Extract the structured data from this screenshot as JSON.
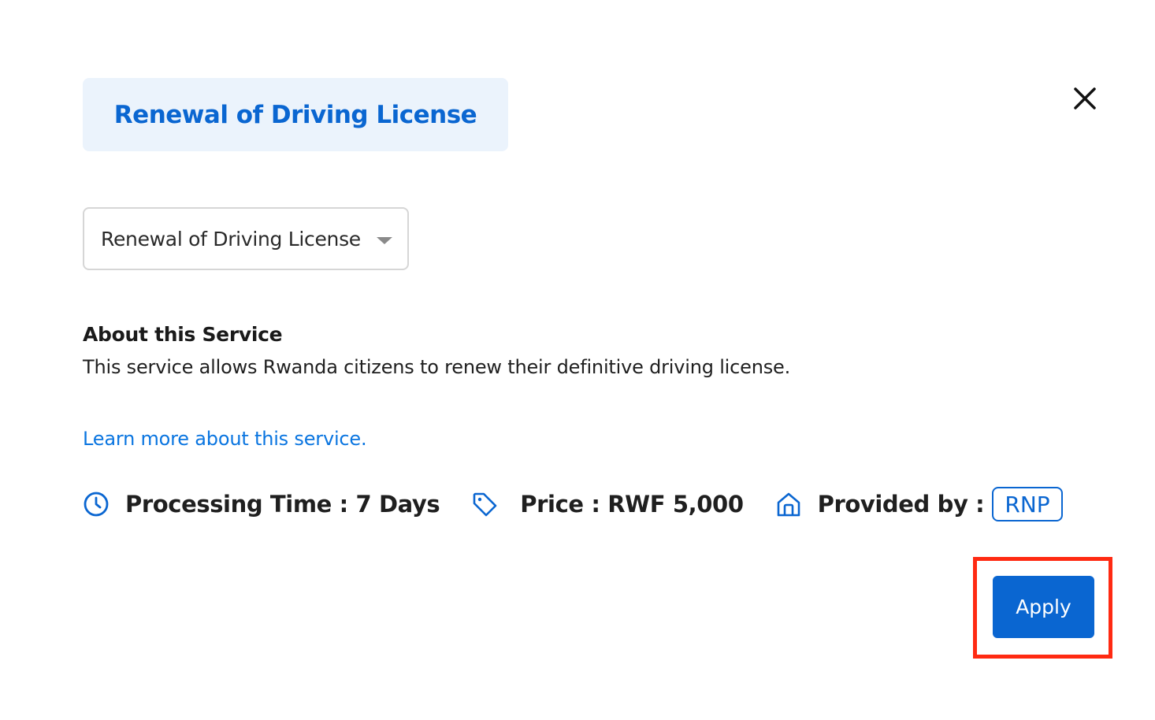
{
  "header": {
    "title": "Renewal of Driving License",
    "close_icon": "close-icon"
  },
  "service_select": {
    "selected_value": "Renewal of Driving License",
    "caret_icon": "chevron-down-icon"
  },
  "about": {
    "heading": "About this Service",
    "description": "This service allows Rwanda citizens to renew their definitive driving license.",
    "learn_more_link": "Learn more about this service."
  },
  "meta": {
    "processing_time": {
      "icon": "clock-icon",
      "label": "Processing Time : 7 Days"
    },
    "price": {
      "icon": "price-tag-icon",
      "label": "Price : RWF 5,000"
    },
    "provider": {
      "icon": "home-icon",
      "label": "Provided by :",
      "badge": "RNP"
    }
  },
  "actions": {
    "apply_label": "Apply"
  },
  "colors": {
    "brand_blue": "#0a66d1",
    "title_chip_bg": "#ebf3fc",
    "link_blue": "#0a75e0",
    "highlight_red": "#ff2a12"
  }
}
